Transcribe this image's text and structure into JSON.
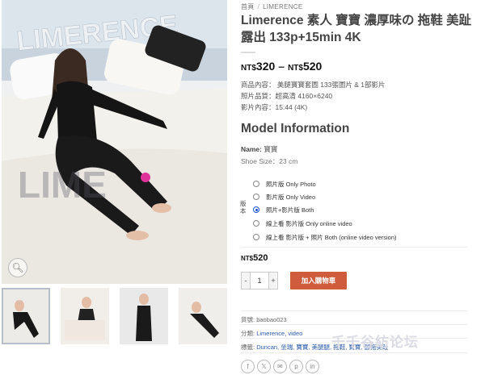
{
  "breadcrumb": {
    "home": "首頁",
    "separator": "/",
    "category": "LIMERENCE"
  },
  "product": {
    "title": "Limerence 素人 寶寶 濃厚味の 拖鞋 美趾露出 133p+15min 4K",
    "price_min_currency": "NT$",
    "price_min": "320",
    "price_max_currency": "NT$",
    "price_max": "520",
    "price_dash": "–",
    "specs": [
      "商品內容： 美腿寶寶套圖 133張圖片 & 1部影片",
      "照片品質：超高清 4160×6240",
      "影片內容：15:44 (4K)"
    ]
  },
  "model": {
    "heading": "Model Information",
    "name_label": "Name:",
    "name_value": "寶寶",
    "shoe_size": "Shoe Size：23 cm"
  },
  "variant": {
    "label": "版本",
    "options": [
      {
        "label": "照片版 Only Photo",
        "checked": false
      },
      {
        "label": "影片版 Only Video",
        "checked": false
      },
      {
        "label": "照片+影片版 Both",
        "checked": true
      },
      {
        "label": "線上看 影片版 Only online video",
        "checked": false
      },
      {
        "label": "線上看 影片版 + 照片 Both (online video version)",
        "checked": false
      }
    ]
  },
  "selected_price": {
    "currency": "NT$",
    "value": "520"
  },
  "cart": {
    "minus": "-",
    "quantity": "1",
    "plus": "+",
    "add_label": "加入購物車"
  },
  "meta": {
    "sku_label": "貨號:",
    "sku_value": "baobao023",
    "category_label": "分類:",
    "category_value": "Limerence, video",
    "tags_label": "標籤:",
    "tags_value": "Duncan, 坐瑞, 寶寶, 美腿腿, 拖鞋, 寶寶, 腳拖美趾"
  },
  "social_icons": [
    "facebook-icon",
    "twitter-icon",
    "email-icon",
    "pinterest-icon",
    "linkedin-icon"
  ],
  "watermark": "千千谷紡论坛",
  "image_logo": "LIMERENCE",
  "colors": {
    "accent": "#cf5c3d",
    "radio": "#1a4fd6",
    "link": "#2b5aa8"
  }
}
